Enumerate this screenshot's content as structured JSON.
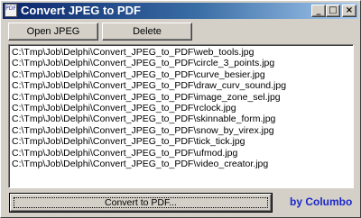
{
  "window": {
    "title": "Convert JPEG to PDF",
    "icon_text": "PDF",
    "minimize_glyph": "_",
    "maximize_glyph": "□",
    "close_glyph": "×"
  },
  "toolbar": {
    "open_label": "Open JPEG",
    "delete_label": "Delete"
  },
  "file_list": [
    "C:\\Tmp\\Job\\Delphi\\Convert_JPEG_to_PDF\\web_tools.jpg",
    "C:\\Tmp\\Job\\Delphi\\Convert_JPEG_to_PDF\\circle_3_points.jpg",
    "C:\\Tmp\\Job\\Delphi\\Convert_JPEG_to_PDF\\curve_besier.jpg",
    "C:\\Tmp\\Job\\Delphi\\Convert_JPEG_to_PDF\\draw_curv_sound.jpg",
    "C:\\Tmp\\Job\\Delphi\\Convert_JPEG_to_PDF\\image_zone_sel.jpg",
    "C:\\Tmp\\Job\\Delphi\\Convert_JPEG_to_PDF\\rclock.jpg",
    "C:\\Tmp\\Job\\Delphi\\Convert_JPEG_to_PDF\\skinnable_form.jpg",
    "C:\\Tmp\\Job\\Delphi\\Convert_JPEG_to_PDF\\snow_by_virex.jpg",
    "C:\\Tmp\\Job\\Delphi\\Convert_JPEG_to_PDF\\tick_tick.jpg",
    "C:\\Tmp\\Job\\Delphi\\Convert_JPEG_to_PDF\\ufmod.jpg",
    "C:\\Tmp\\Job\\Delphi\\Convert_JPEG_to_PDF\\video_creator.jpg"
  ],
  "footer": {
    "convert_label": "Convert to PDF...",
    "byline": "by Columbo"
  },
  "colors": {
    "titlebar_start": "#0a246a",
    "titlebar_end": "#a6caf0",
    "face": "#d4d0c8",
    "byline": "#1a28c8"
  }
}
